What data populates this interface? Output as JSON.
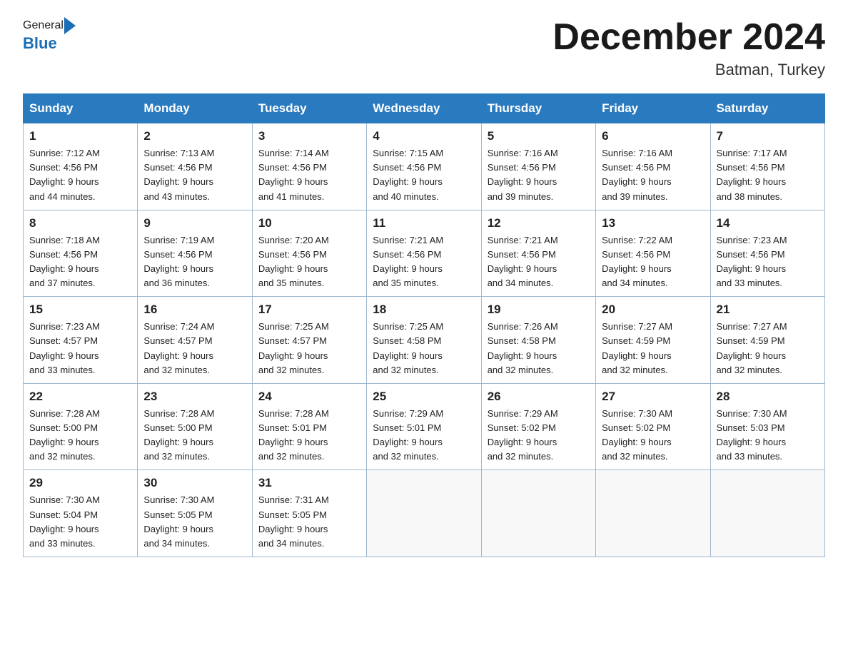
{
  "logo": {
    "general": "General",
    "blue": "Blue"
  },
  "title": "December 2024",
  "location": "Batman, Turkey",
  "headers": [
    "Sunday",
    "Monday",
    "Tuesday",
    "Wednesday",
    "Thursday",
    "Friday",
    "Saturday"
  ],
  "weeks": [
    [
      {
        "day": "1",
        "sunrise": "7:12 AM",
        "sunset": "4:56 PM",
        "daylight": "9 hours and 44 minutes."
      },
      {
        "day": "2",
        "sunrise": "7:13 AM",
        "sunset": "4:56 PM",
        "daylight": "9 hours and 43 minutes."
      },
      {
        "day": "3",
        "sunrise": "7:14 AM",
        "sunset": "4:56 PM",
        "daylight": "9 hours and 41 minutes."
      },
      {
        "day": "4",
        "sunrise": "7:15 AM",
        "sunset": "4:56 PM",
        "daylight": "9 hours and 40 minutes."
      },
      {
        "day": "5",
        "sunrise": "7:16 AM",
        "sunset": "4:56 PM",
        "daylight": "9 hours and 39 minutes."
      },
      {
        "day": "6",
        "sunrise": "7:16 AM",
        "sunset": "4:56 PM",
        "daylight": "9 hours and 39 minutes."
      },
      {
        "day": "7",
        "sunrise": "7:17 AM",
        "sunset": "4:56 PM",
        "daylight": "9 hours and 38 minutes."
      }
    ],
    [
      {
        "day": "8",
        "sunrise": "7:18 AM",
        "sunset": "4:56 PM",
        "daylight": "9 hours and 37 minutes."
      },
      {
        "day": "9",
        "sunrise": "7:19 AM",
        "sunset": "4:56 PM",
        "daylight": "9 hours and 36 minutes."
      },
      {
        "day": "10",
        "sunrise": "7:20 AM",
        "sunset": "4:56 PM",
        "daylight": "9 hours and 35 minutes."
      },
      {
        "day": "11",
        "sunrise": "7:21 AM",
        "sunset": "4:56 PM",
        "daylight": "9 hours and 35 minutes."
      },
      {
        "day": "12",
        "sunrise": "7:21 AM",
        "sunset": "4:56 PM",
        "daylight": "9 hours and 34 minutes."
      },
      {
        "day": "13",
        "sunrise": "7:22 AM",
        "sunset": "4:56 PM",
        "daylight": "9 hours and 34 minutes."
      },
      {
        "day": "14",
        "sunrise": "7:23 AM",
        "sunset": "4:56 PM",
        "daylight": "9 hours and 33 minutes."
      }
    ],
    [
      {
        "day": "15",
        "sunrise": "7:23 AM",
        "sunset": "4:57 PM",
        "daylight": "9 hours and 33 minutes."
      },
      {
        "day": "16",
        "sunrise": "7:24 AM",
        "sunset": "4:57 PM",
        "daylight": "9 hours and 32 minutes."
      },
      {
        "day": "17",
        "sunrise": "7:25 AM",
        "sunset": "4:57 PM",
        "daylight": "9 hours and 32 minutes."
      },
      {
        "day": "18",
        "sunrise": "7:25 AM",
        "sunset": "4:58 PM",
        "daylight": "9 hours and 32 minutes."
      },
      {
        "day": "19",
        "sunrise": "7:26 AM",
        "sunset": "4:58 PM",
        "daylight": "9 hours and 32 minutes."
      },
      {
        "day": "20",
        "sunrise": "7:27 AM",
        "sunset": "4:59 PM",
        "daylight": "9 hours and 32 minutes."
      },
      {
        "day": "21",
        "sunrise": "7:27 AM",
        "sunset": "4:59 PM",
        "daylight": "9 hours and 32 minutes."
      }
    ],
    [
      {
        "day": "22",
        "sunrise": "7:28 AM",
        "sunset": "5:00 PM",
        "daylight": "9 hours and 32 minutes."
      },
      {
        "day": "23",
        "sunrise": "7:28 AM",
        "sunset": "5:00 PM",
        "daylight": "9 hours and 32 minutes."
      },
      {
        "day": "24",
        "sunrise": "7:28 AM",
        "sunset": "5:01 PM",
        "daylight": "9 hours and 32 minutes."
      },
      {
        "day": "25",
        "sunrise": "7:29 AM",
        "sunset": "5:01 PM",
        "daylight": "9 hours and 32 minutes."
      },
      {
        "day": "26",
        "sunrise": "7:29 AM",
        "sunset": "5:02 PM",
        "daylight": "9 hours and 32 minutes."
      },
      {
        "day": "27",
        "sunrise": "7:30 AM",
        "sunset": "5:02 PM",
        "daylight": "9 hours and 32 minutes."
      },
      {
        "day": "28",
        "sunrise": "7:30 AM",
        "sunset": "5:03 PM",
        "daylight": "9 hours and 33 minutes."
      }
    ],
    [
      {
        "day": "29",
        "sunrise": "7:30 AM",
        "sunset": "5:04 PM",
        "daylight": "9 hours and 33 minutes."
      },
      {
        "day": "30",
        "sunrise": "7:30 AM",
        "sunset": "5:05 PM",
        "daylight": "9 hours and 34 minutes."
      },
      {
        "day": "31",
        "sunrise": "7:31 AM",
        "sunset": "5:05 PM",
        "daylight": "9 hours and 34 minutes."
      },
      null,
      null,
      null,
      null
    ]
  ],
  "labels": {
    "sunrise": "Sunrise:",
    "sunset": "Sunset:",
    "daylight": "Daylight:"
  }
}
